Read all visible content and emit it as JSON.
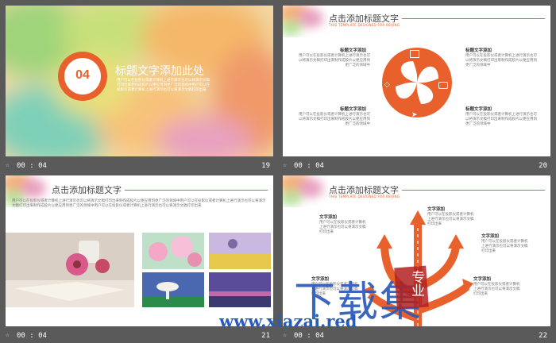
{
  "slides": {
    "s19": {
      "number_badge": "04",
      "title": "标题文字添加此处",
      "body": "用户可以在投影仪或者计算机上进行演示也可以将演示文稿打印出来制作成胶片以便应用到更广泛的领域中用户可以在投影仪或者计算机上进行演示也可以将演示文稿打印出来"
    },
    "s20": {
      "title": "点击添加标题文字",
      "subtitle": "THIS TEMPLATE DESIGNED FOR BEIJING",
      "blocks": [
        {
          "head": "标题文字添加",
          "body": "用户可以在投影仪或者计算机上进行演示也可以将演示文稿打印出来制作成胶片以便应用到更广泛的领域中"
        },
        {
          "head": "标题文字添加",
          "body": "用户可以在投影仪或者计算机上进行演示也可以将演示文稿打印出来制作成胶片以便应用到更广泛的领域中"
        },
        {
          "head": "标题文字添加",
          "body": "用户可以在投影仪或者计算机上进行演示也可以将演示文稿打印出来制作成胶片以便应用到更广泛的领域中"
        },
        {
          "head": "标题文字添加",
          "body": "用户可以在投影仪或者计算机上进行演示也可以将演示文稿打印出来制作成胶片以便应用到更广泛的领域中"
        }
      ]
    },
    "s21": {
      "title": "点击添加标题文字",
      "body": "用户可以在投影仪或者计算机上进行演示也可以将演示文稿打印出来制作成胶片以便应用到更广泛的领域中用户可以在投影仪或者计算机上进行演示也可以将演示文稿打印出来制作成胶片以便应用到更广泛的领域中用户可以在投影仪或者计算机上进行演示也可以将演示文稿打印出来"
    },
    "s22": {
      "title": "点击添加标题文字",
      "subtitle": "THIS TEMPLATE DESIGNED FOR BEIJING",
      "blocks": [
        {
          "head": "文字添加",
          "body": "用户可以在投影仪或者计算机上进行演示也可以将演示文稿打印出来"
        },
        {
          "head": "文字添加",
          "body": "用户可以在投影仪或者计算机上进行演示也可以将演示文稿打印出来"
        },
        {
          "head": "文字添加",
          "body": "用户可以在投影仪或者计算机上进行演示也可以将演示文稿打印出来"
        },
        {
          "head": "文字添加",
          "body": "用户可以在投影仪或者计算机上进行演示也可以将演示文稿打印出来"
        },
        {
          "head": "文字添加",
          "body": "用户可以在投影仪或者计算机上进行演示也可以将演示文稿打印出来"
        }
      ]
    }
  },
  "captions": [
    {
      "time": "00 : 04",
      "number": "19"
    },
    {
      "time": "00 : 04",
      "number": "20"
    },
    {
      "time": "00 : 04",
      "number": "21"
    },
    {
      "time": "00 : 04",
      "number": "22"
    }
  ],
  "watermark": {
    "big_text": "下载集",
    "stamp_text": "专业",
    "url": "www.xiazai.red"
  },
  "colors": {
    "accent": "#e8612c",
    "background": "#5a5a5a",
    "watermark_blue": "#2a5bb8",
    "stamp_red": "#b22222"
  }
}
